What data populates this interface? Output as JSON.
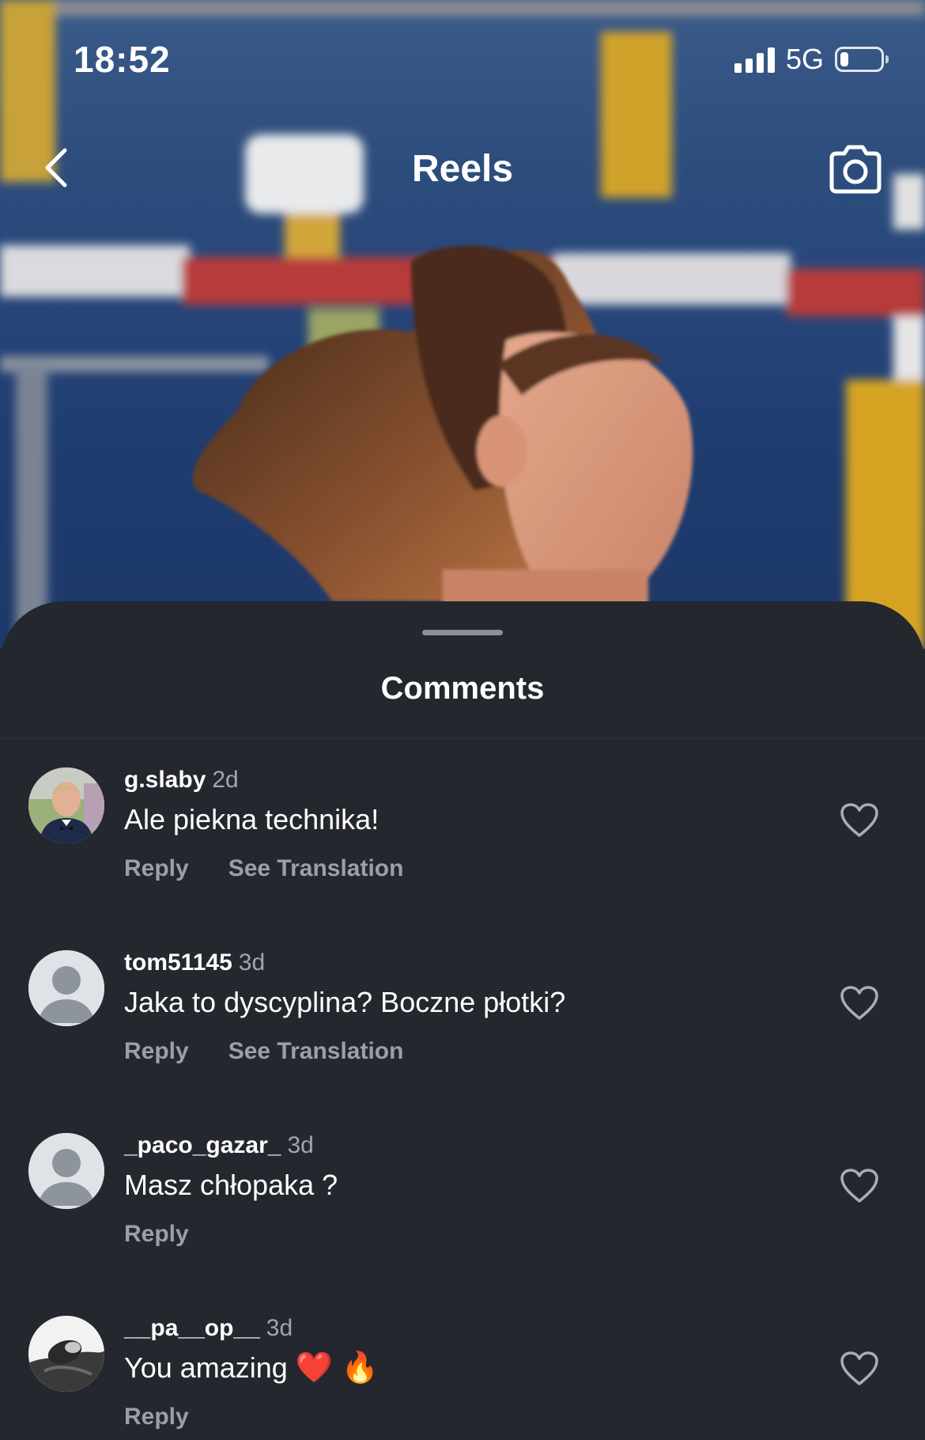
{
  "status_bar": {
    "time": "18:52",
    "network": "5G",
    "signal_bars": 4,
    "battery_level": 0.2
  },
  "header": {
    "title": "Reels",
    "back_icon": "chevron-left-icon",
    "camera_icon": "camera-icon"
  },
  "sheet": {
    "title": "Comments"
  },
  "comments": [
    {
      "user": "g.slaby",
      "time": "2d",
      "text": "Ale piekna technika!",
      "reply_label": "Reply",
      "translation_label": "See Translation",
      "avatar": "photo"
    },
    {
      "user": "tom51145",
      "time": "3d",
      "text": "Jaka to dyscyplina? Boczne płotki?",
      "reply_label": "Reply",
      "translation_label": "See Translation",
      "avatar": "default"
    },
    {
      "user": "_paco_gazar_",
      "time": "3d",
      "text": "Masz chłopaka ?",
      "reply_label": "Reply",
      "avatar": "default"
    },
    {
      "user": "__pa__op__",
      "time": "3d",
      "text": "You amazing",
      "emojis": "❤️ 🔥",
      "reply_label": "Reply",
      "avatar": "photo-bw"
    }
  ],
  "colors": {
    "sheet_bg": "#24272e",
    "text_primary": "#ffffff",
    "text_secondary": "#9ba0a8"
  }
}
